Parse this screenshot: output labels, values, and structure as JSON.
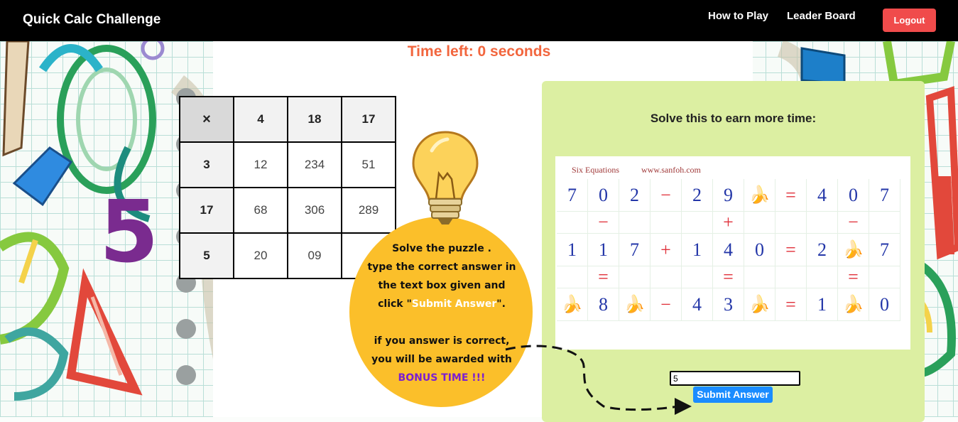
{
  "navbar": {
    "brand": "Quick Calc Challenge",
    "links": [
      "How to Play",
      "Leader Board"
    ],
    "logout": "Logout"
  },
  "timer": "Time left: 0 seconds",
  "grid": {
    "corner": "×",
    "cols": [
      "4",
      "18",
      "17"
    ],
    "rows": [
      {
        "head": "3",
        "cells": [
          "12",
          "234",
          "51"
        ]
      },
      {
        "head": "17",
        "cells": [
          "68",
          "306",
          "289"
        ]
      },
      {
        "head": "5",
        "cells": [
          "20",
          "09",
          ""
        ]
      }
    ]
  },
  "hint": {
    "line1": "Solve the puzzle .",
    "line2": "type the correct answer in",
    "line3": "the text box given and",
    "line4a": "click \"",
    "line4b": "Submit Answer",
    "line4c": "\".",
    "line5": "if you answer is correct,",
    "line6": "you will be awarded with",
    "line7": "BONUS TIME !!!"
  },
  "panel": {
    "title": "Solve this to earn more time:",
    "puzzle_header": [
      "Six Equations",
      "www.sanfoh.com"
    ],
    "rows": [
      [
        "7",
        "0",
        "2",
        "−",
        "2",
        "9",
        "🍌",
        "=",
        "4",
        "0",
        "7"
      ],
      [
        "",
        "−",
        "",
        "",
        "",
        "+",
        "",
        "",
        "",
        "−",
        ""
      ],
      [
        "1",
        "1",
        "7",
        "+",
        "1",
        "4",
        "0",
        "=",
        "2",
        "🍌",
        "7"
      ],
      [
        "",
        "=",
        "",
        "",
        "",
        "=",
        "",
        "",
        "",
        "=",
        ""
      ],
      [
        "🍌",
        "8",
        "🍌",
        "−",
        "4",
        "3",
        "🍌",
        "=",
        "1",
        "🍌",
        "0"
      ]
    ],
    "answer_value": "5",
    "submit_label": "Submit Answer"
  },
  "colors": {
    "timer": "#f2663e",
    "panel_bg": "#dcefa2",
    "hint_circle": "#fbbf2a",
    "logout": "#f04b4b",
    "submit": "#1a8cff"
  }
}
